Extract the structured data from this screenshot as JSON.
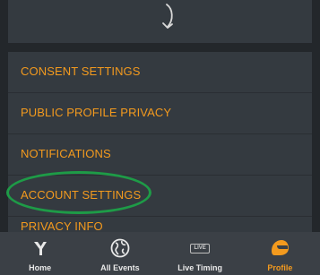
{
  "menu": {
    "items": [
      {
        "label": "CONSENT SETTINGS"
      },
      {
        "label": "PUBLIC PROFILE PRIVACY"
      },
      {
        "label": "NOTIFICATIONS"
      },
      {
        "label": "ACCOUNT SETTINGS"
      },
      {
        "label": "PRIVACY INFO"
      }
    ]
  },
  "tabbar": {
    "tabs": [
      {
        "label": "Home",
        "icon": "home-logo-icon"
      },
      {
        "label": "All Events",
        "icon": "globe-icon"
      },
      {
        "label": "Live Timing",
        "icon": "live-badge-icon",
        "badge": "LIVE"
      },
      {
        "label": "Profile",
        "icon": "helmet-icon",
        "active": true
      }
    ]
  },
  "colors": {
    "accent": "#f39a1e",
    "highlight": "#1e9b47",
    "background": "#23272b",
    "card": "#343a40"
  }
}
